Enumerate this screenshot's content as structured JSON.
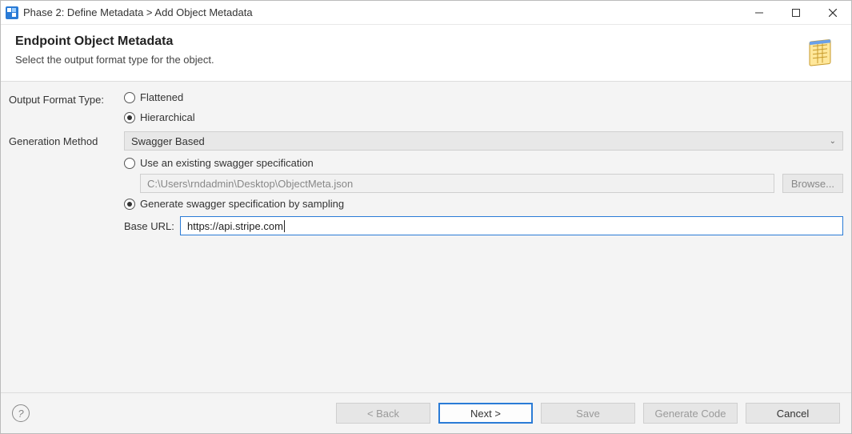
{
  "window": {
    "title": "Phase 2: Define Metadata > Add Object Metadata"
  },
  "banner": {
    "title": "Endpoint Object Metadata",
    "subtitle": "Select the output format type for the object."
  },
  "form": {
    "output_format_label": "Output Format Type:",
    "flattened_label": "Flattened",
    "hierarchical_label": "Hierarchical",
    "output_format_selected": "hierarchical",
    "generation_method_label": "Generation Method",
    "generation_method_value": "Swagger Based",
    "use_existing_label": "Use an existing swagger specification",
    "existing_path_value": "C:\\Users\\rndadmin\\Desktop\\ObjectMeta.json",
    "browse_label": "Browse...",
    "generate_sampling_label": "Generate swagger specification by sampling",
    "swagger_source_selected": "sampling",
    "base_url_label": "Base URL:",
    "base_url_value": "https://api.stripe.com"
  },
  "footer": {
    "back": "< Back",
    "next": "Next >",
    "save": "Save",
    "generate_code": "Generate Code",
    "cancel": "Cancel"
  }
}
